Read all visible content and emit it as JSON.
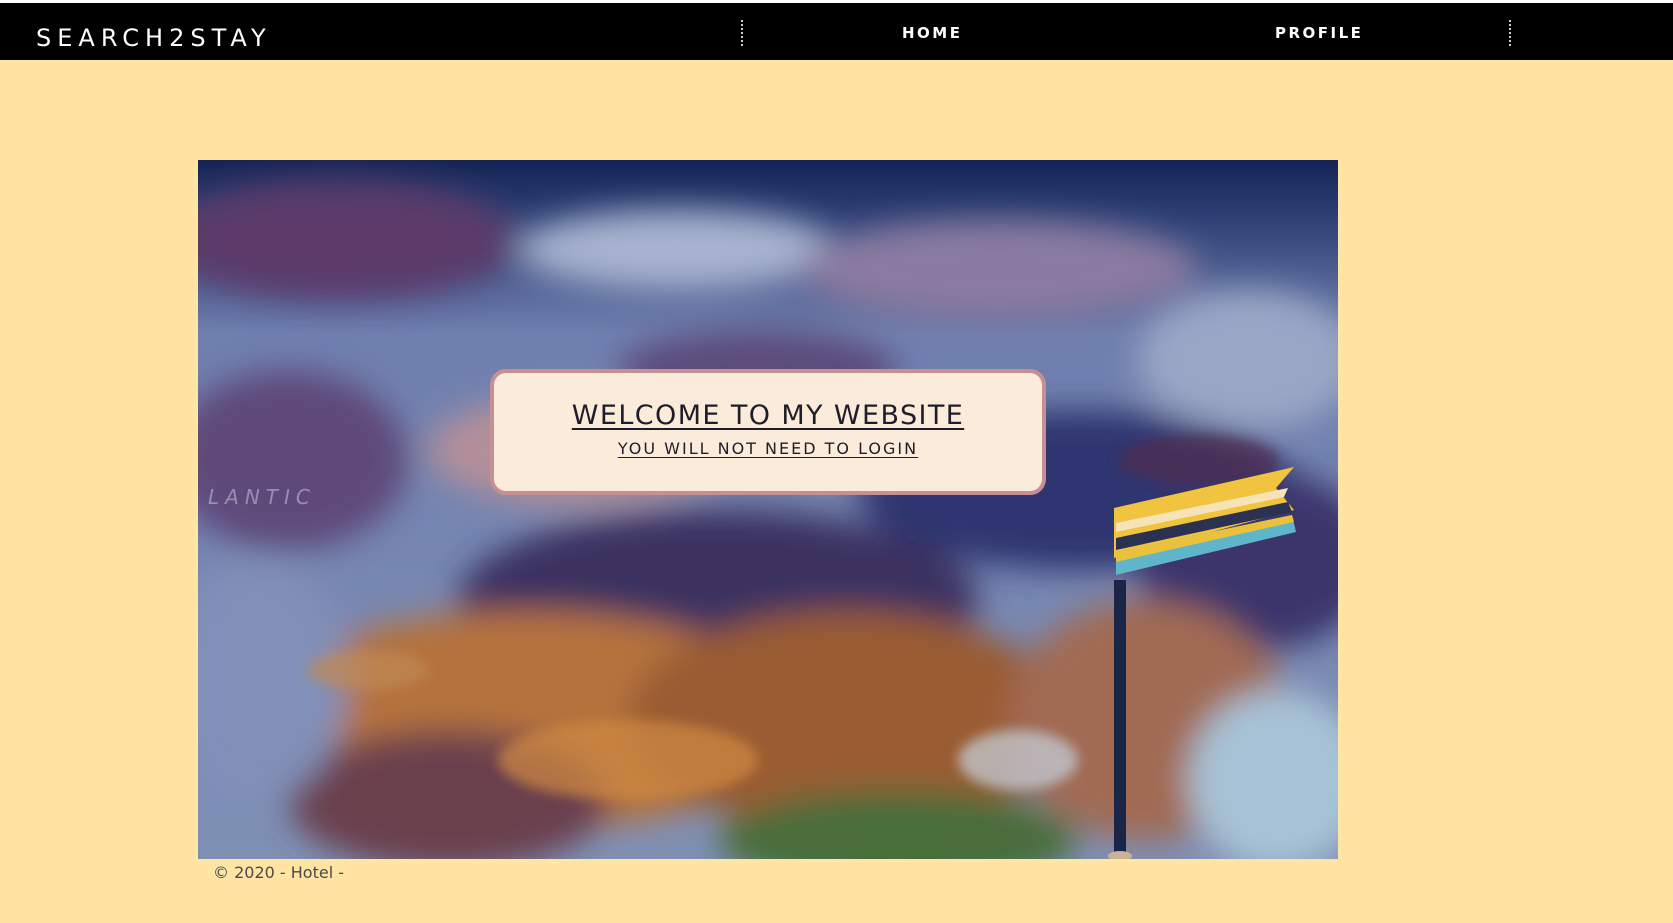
{
  "header": {
    "brand": "SEARCH2STAY",
    "nav": [
      {
        "label": "HOME"
      },
      {
        "label": "PROFILE"
      }
    ]
  },
  "hero": {
    "image": "world-map-with-flag-pin",
    "title": "WELCOME TO MY WEBSITE",
    "subtitle": "YOU WILL NOT NEED TO LOGIN",
    "map_text": "LANTIC"
  },
  "footer": {
    "text": "© 2020 - Hotel -"
  },
  "colors": {
    "page_background": "#ffe4a3",
    "navbar": "#000000",
    "welcome_box": "#fbebdb",
    "welcome_border": "#c58f93"
  }
}
